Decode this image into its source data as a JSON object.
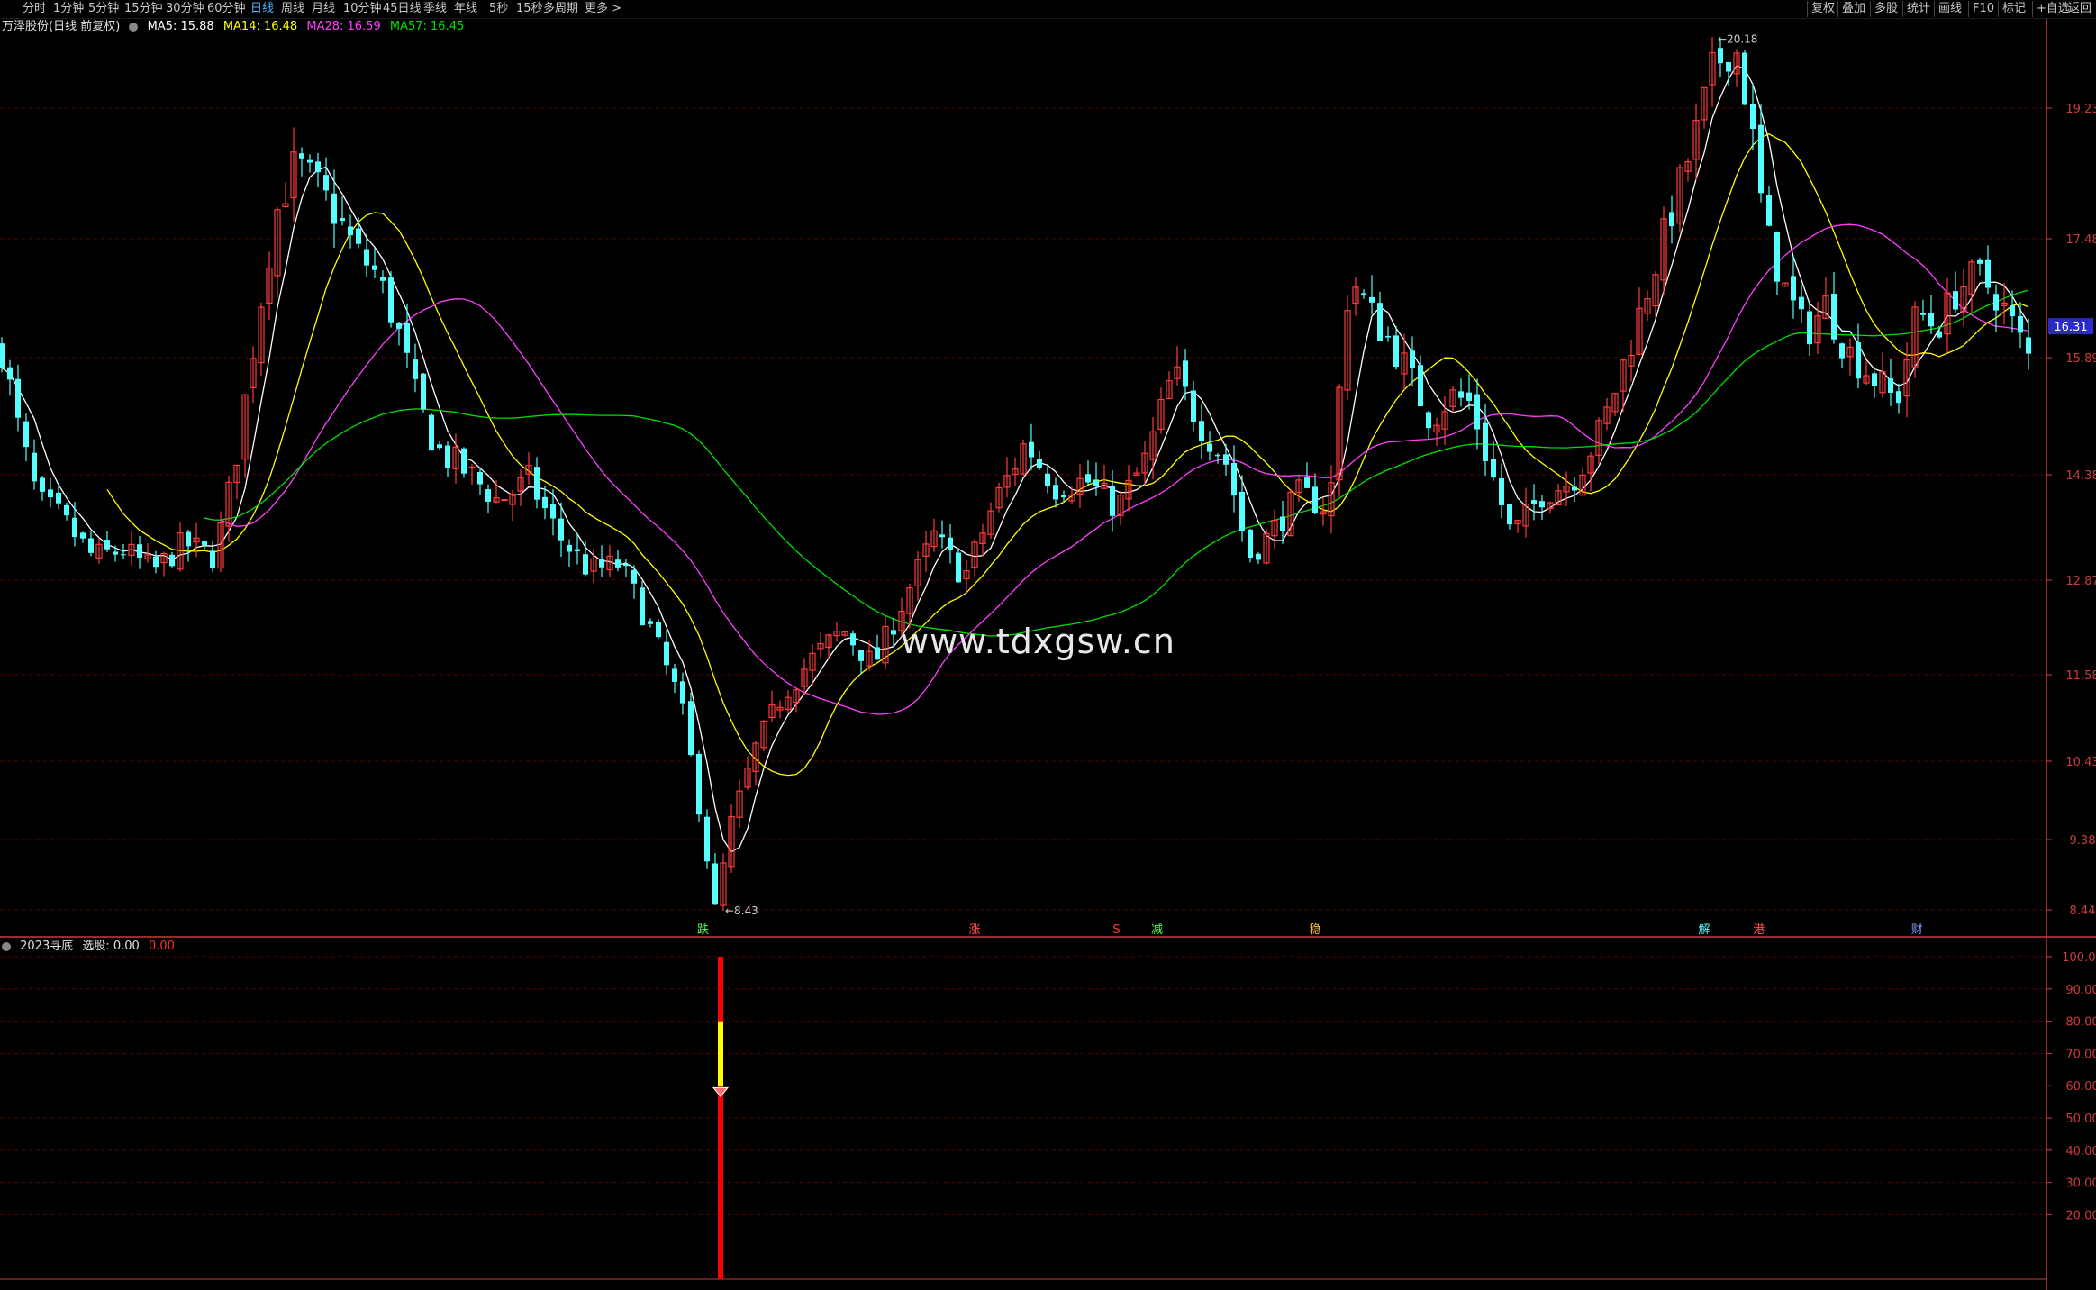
{
  "toolbar": {
    "periods": [
      "分时",
      "1分钟",
      "5分钟",
      "15分钟",
      "30分钟",
      "60分钟",
      "日线",
      "周线",
      "月线",
      "10分钟",
      "45日线",
      "季线",
      "年线",
      "5秒",
      "15秒",
      "多周期",
      "更多 >"
    ],
    "active_period": "日线",
    "right_buttons": [
      "复权",
      "叠加",
      "多股",
      "统计",
      "画线",
      "F10",
      "标记",
      "+自选",
      "返回"
    ]
  },
  "legend": {
    "stock": "万泽股份(日线 前复权)",
    "ma5": "MA5: 15.88",
    "ma14": "MA14: 16.48",
    "ma28": "MA28: 16.59",
    "ma57": "MA57: 16.45"
  },
  "indicator_legend": {
    "name": "2023寻底",
    "pick": "选股: 0.00",
    "value": "0.00"
  },
  "watermark": "www.tdxgsw.cn",
  "colors": {
    "up": "#ff3b3b",
    "down": "#54ffff",
    "ma5": "#ffffff",
    "ma14": "#ffff00",
    "ma28": "#ff40ff",
    "ma57": "#00e000",
    "grid": "#5a0000",
    "axis": "#c83c3c",
    "price_tag": "#2b2bc8"
  },
  "chart_data": [
    {
      "type": "candlestick",
      "title": "万泽股份(日线 前复权)",
      "y_ticks": [
        19.23,
        17.48,
        15.89,
        14.38,
        12.87,
        11.58,
        10.43,
        9.38,
        8.44
      ],
      "ylim": [
        8.0,
        20.6
      ],
      "current_price": 16.31,
      "max_label": "20.18",
      "min_label": "8.43",
      "series": [
        {
          "name": "MA5",
          "value": 15.88
        },
        {
          "name": "MA14",
          "value": 16.48
        },
        {
          "name": "MA28",
          "value": 16.59
        },
        {
          "name": "MA57",
          "value": 16.45
        }
      ],
      "trend_keypoints": [
        [
          0,
          16.0
        ],
        [
          8,
          15.0
        ],
        [
          18,
          14.0
        ],
        [
          28,
          13.8
        ],
        [
          45,
          13.2
        ],
        [
          60,
          13.3
        ],
        [
          75,
          13.0
        ],
        [
          90,
          13.4
        ],
        [
          105,
          13.2
        ],
        [
          115,
          14.5
        ],
        [
          125,
          16.2
        ],
        [
          135,
          17.8
        ],
        [
          145,
          18.5
        ],
        [
          155,
          18.2
        ],
        [
          165,
          17.8
        ],
        [
          175,
          17.3
        ],
        [
          185,
          17.0
        ],
        [
          195,
          16.3
        ],
        [
          205,
          15.3
        ],
        [
          215,
          14.7
        ],
        [
          230,
          14.4
        ],
        [
          245,
          14.0
        ],
        [
          260,
          14.3
        ],
        [
          275,
          13.5
        ],
        [
          290,
          13.0
        ],
        [
          305,
          13.1
        ],
        [
          320,
          12.2
        ],
        [
          335,
          11.2
        ],
        [
          345,
          9.7
        ],
        [
          352,
          8.43
        ],
        [
          360,
          9.6
        ],
        [
          372,
          10.6
        ],
        [
          385,
          11.3
        ],
        [
          400,
          11.8
        ],
        [
          415,
          12.2
        ],
        [
          430,
          11.7
        ],
        [
          445,
          12.6
        ],
        [
          460,
          13.5
        ],
        [
          475,
          12.9
        ],
        [
          490,
          14.0
        ],
        [
          505,
          14.8
        ],
        [
          520,
          14.2
        ],
        [
          535,
          14.3
        ],
        [
          550,
          13.9
        ],
        [
          565,
          14.6
        ],
        [
          578,
          15.7
        ],
        [
          590,
          15.1
        ],
        [
          605,
          14.5
        ],
        [
          615,
          13.2
        ],
        [
          625,
          13.5
        ],
        [
          640,
          14.1
        ],
        [
          655,
          13.9
        ],
        [
          665,
          17.0
        ],
        [
          675,
          16.5
        ],
        [
          690,
          15.9
        ],
        [
          705,
          15.1
        ],
        [
          715,
          15.4
        ],
        [
          725,
          15.3
        ],
        [
          735,
          14.4
        ],
        [
          745,
          13.5
        ],
        [
          760,
          14.1
        ],
        [
          775,
          14.3
        ],
        [
          790,
          15.0
        ],
        [
          805,
          16.2
        ],
        [
          820,
          17.5
        ],
        [
          835,
          18.8
        ],
        [
          845,
          19.8
        ],
        [
          855,
          20.1
        ],
        [
          862,
          19.2
        ],
        [
          870,
          17.6
        ],
        [
          880,
          16.8
        ],
        [
          890,
          16.2
        ],
        [
          900,
          16.6
        ],
        [
          910,
          16.0
        ],
        [
          925,
          15.6
        ],
        [
          935,
          15.3
        ],
        [
          945,
          16.5
        ],
        [
          955,
          16.3
        ],
        [
          965,
          16.8
        ],
        [
          975,
          17.0
        ],
        [
          985,
          16.7
        ],
        [
          1000,
          15.9
        ]
      ]
    },
    {
      "type": "bar",
      "title": "2023寻底",
      "y_ticks": [
        100.0,
        90.0,
        80.0,
        70.0,
        60.0,
        50.0,
        40.0,
        30.0,
        20.0
      ],
      "ylim": [
        0,
        100
      ],
      "signal_at_index": 352,
      "segments": [
        {
          "from": 0,
          "to": 60,
          "color": "#ff0000"
        },
        {
          "from": 60,
          "to": 80,
          "color": "#ffff00"
        },
        {
          "from": 80,
          "to": 100,
          "color": "#ff0000"
        }
      ],
      "marker_value": 58
    }
  ],
  "event_labels": [
    {
      "text": "跌",
      "index": 346,
      "color": "#54ff54"
    },
    {
      "text": "涨",
      "index": 480,
      "color": "#ff5050"
    },
    {
      "text": "S",
      "index": 550,
      "color": "#ff3b3b"
    },
    {
      "text": "减",
      "index": 570,
      "color": "#54ff54"
    },
    {
      "text": "稳",
      "index": 648,
      "color": "#ffbb44"
    },
    {
      "text": "解",
      "index": 840,
      "color": "#54ffff"
    },
    {
      "text": "港",
      "index": 867,
      "color": "#ff5050"
    },
    {
      "text": "财",
      "index": 945,
      "color": "#7f9fff"
    }
  ]
}
